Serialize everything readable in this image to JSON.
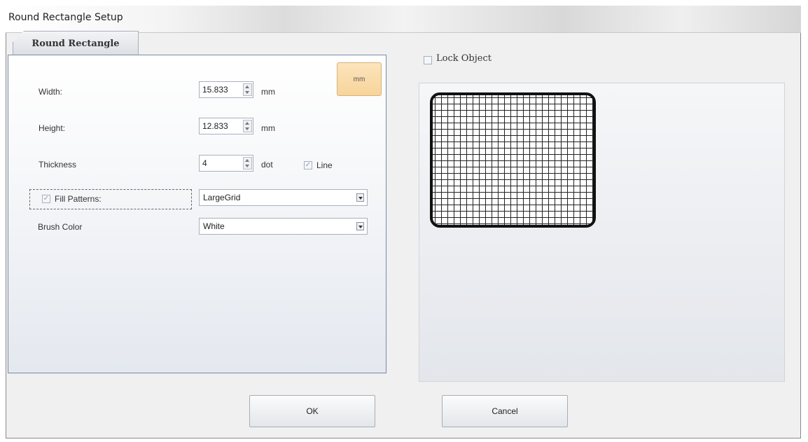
{
  "window": {
    "title": "Round Rectangle Setup"
  },
  "tab": {
    "label": "Round Rectangle"
  },
  "unit_button": {
    "label": "mm"
  },
  "fields": {
    "width": {
      "label": "Width:",
      "value": "15.833",
      "unit": "mm"
    },
    "height": {
      "label": "Height:",
      "value": "12.833",
      "unit": "mm"
    },
    "thickness": {
      "label": "Thickness",
      "value": "4",
      "unit": "dot"
    }
  },
  "line_checkbox": {
    "label": "Line",
    "checked": true
  },
  "fill_patterns": {
    "label": "Fill Patterns:",
    "checked": true,
    "selected": "LargeGrid"
  },
  "brush_color": {
    "label": "Brush Color",
    "selected": "White"
  },
  "lock_object": {
    "label": "Lock Object",
    "checked": false
  },
  "buttons": {
    "ok": "OK",
    "cancel": "Cancel"
  },
  "colors": {
    "unit_button_bg": "#f7d49a",
    "panel_border": "#7a8aa6",
    "shape_border": "#111111"
  }
}
